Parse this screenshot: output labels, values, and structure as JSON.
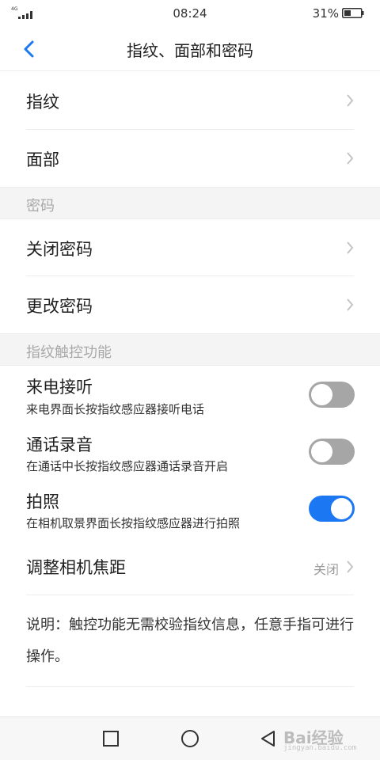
{
  "status_bar": {
    "network_label": "4G",
    "time": "08:24",
    "battery_percent": "31%"
  },
  "header": {
    "title": "指纹、面部和密码",
    "back_icon": "chevron-left-icon"
  },
  "biometrics": {
    "items": [
      {
        "label": "指纹"
      },
      {
        "label": "面部"
      }
    ]
  },
  "password_section": {
    "title": "密码",
    "items": [
      {
        "label": "关闭密码"
      },
      {
        "label": "更改密码"
      }
    ]
  },
  "touch_section": {
    "title": "指纹触控功能",
    "toggles": [
      {
        "label": "来电接听",
        "description": "来电界面长按指纹感应器接听电话",
        "enabled": false
      },
      {
        "label": "通话录音",
        "description": "在通话中长按指纹感应器通话录音开启",
        "enabled": false
      },
      {
        "label": "拍照",
        "description": "在相机取景界面长按指纹感应器进行拍照",
        "enabled": true
      }
    ],
    "focus": {
      "label": "调整相机焦距",
      "value": "关闭"
    }
  },
  "note": "说明：触控功能无需校验指纹信息，任意手指可进行操作。",
  "nav_bar": {
    "buttons": [
      "recents-square-icon",
      "home-circle-icon",
      "back-triangle-icon"
    ]
  },
  "watermark": {
    "text": "Bai经验",
    "url": "jingyan.baidu.com"
  },
  "colors": {
    "accent": "#1b78f2",
    "toggle_off": "#a6a6a6",
    "section_bg": "#f4f4f4"
  }
}
